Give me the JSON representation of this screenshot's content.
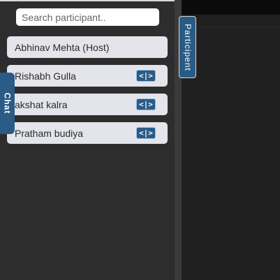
{
  "search": {
    "placeholder": "Search participant.."
  },
  "participants": [
    {
      "name": "Abhinav Mehta (Host)"
    },
    {
      "name": "Rishabh Gulla",
      "action_label": "<|>"
    },
    {
      "name": "akshat kalra",
      "action_label": "<|>"
    },
    {
      "name": "Pratham budiya",
      "action_label": "<|>"
    }
  ],
  "tabs": {
    "chat_label": "Chat",
    "participant_label": "Participent"
  },
  "colors": {
    "accent": "#2a5b86",
    "item_background": "#e4e5ea",
    "sidebar_background": "#2d2d2d"
  }
}
